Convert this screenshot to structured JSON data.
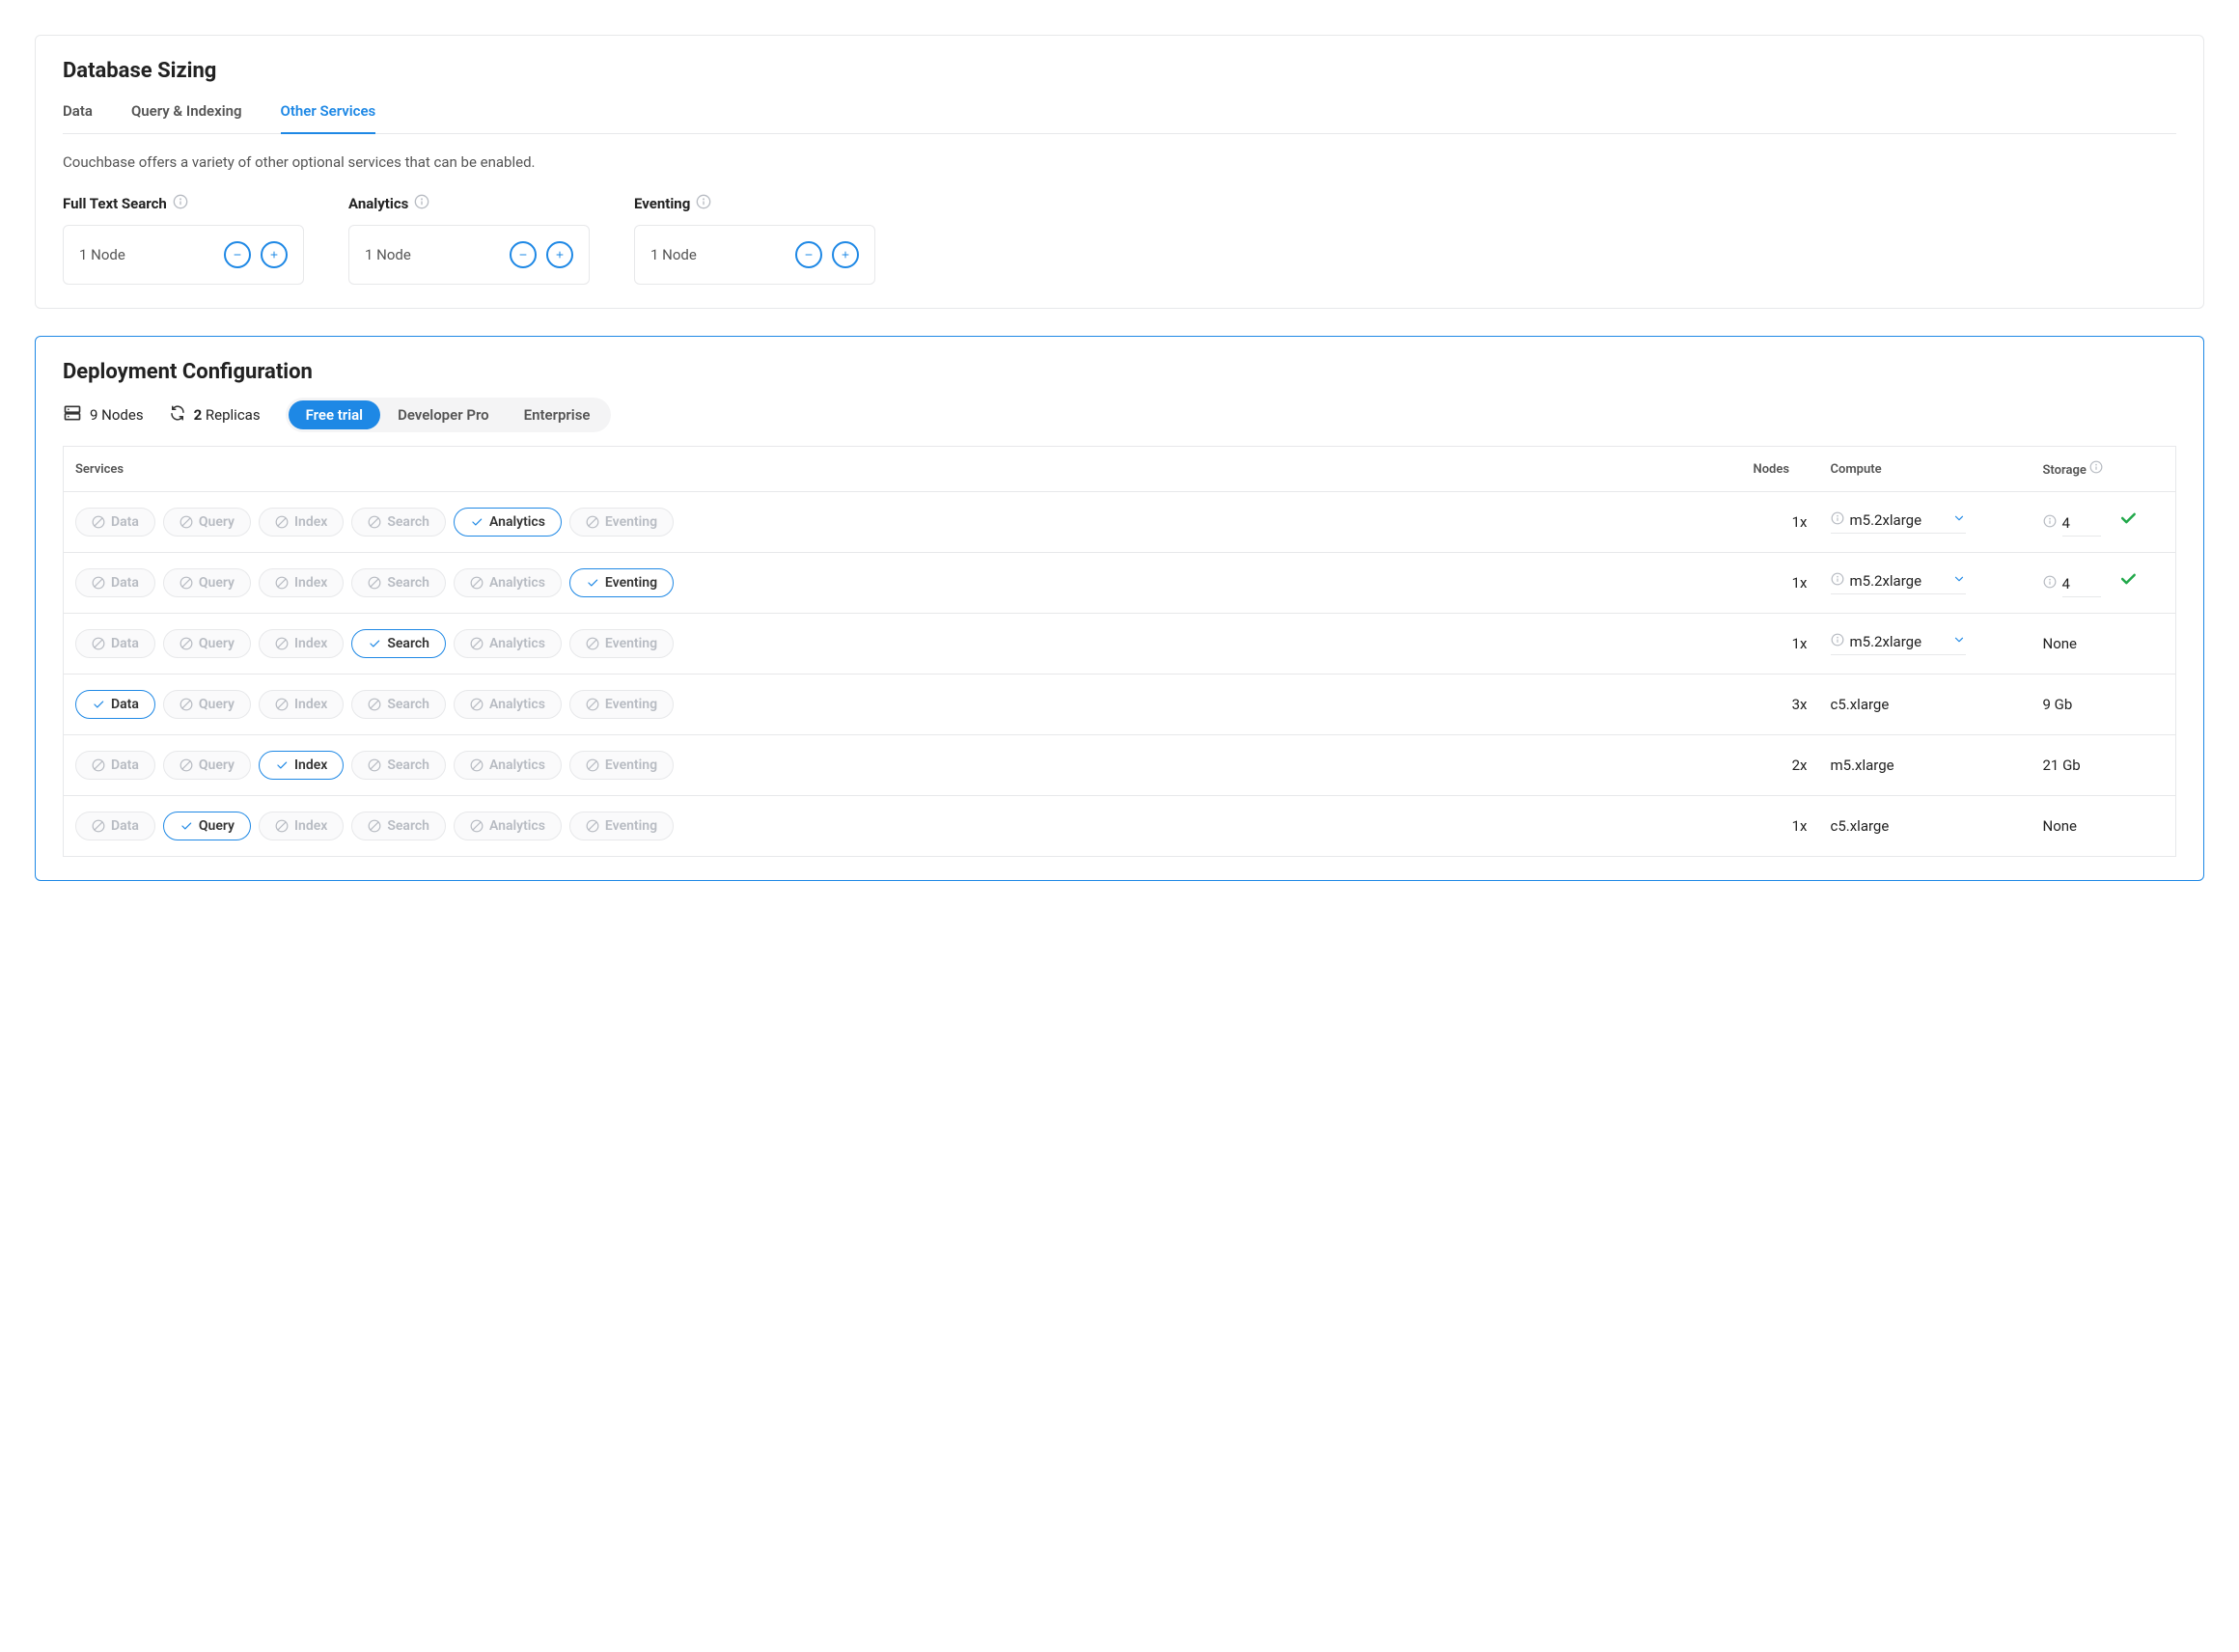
{
  "sizing": {
    "title": "Database Sizing",
    "tabs": [
      "Data",
      "Query & Indexing",
      "Other Services"
    ],
    "tabs_active_index": 2,
    "description": "Couchbase offers a variety of other optional services that can be enabled.",
    "services": {
      "fts": {
        "label": "Full Text Search",
        "value": "1 Node"
      },
      "analytics": {
        "label": "Analytics",
        "value": "1 Node"
      },
      "eventing": {
        "label": "Eventing",
        "value": "1 Node"
      }
    }
  },
  "deployment": {
    "title": "Deployment Configuration",
    "nodes_total": "9 Nodes",
    "replicas_count": "2",
    "replicas_label": "Replicas",
    "plans": [
      "Free trial",
      "Developer Pro",
      "Enterprise"
    ],
    "plans_active_index": 0,
    "columns": {
      "services": "Services",
      "nodes": "Nodes",
      "compute": "Compute",
      "storage": "Storage"
    },
    "service_pills": [
      "Data",
      "Query",
      "Index",
      "Search",
      "Analytics",
      "Eventing"
    ],
    "rows": [
      {
        "active": "Analytics",
        "nodes": "1x",
        "compute": "m5.2xlarge",
        "compute_editable": true,
        "storage": "4",
        "storage_editable": true,
        "storage_ok": true
      },
      {
        "active": "Eventing",
        "nodes": "1x",
        "compute": "m5.2xlarge",
        "compute_editable": true,
        "storage": "4",
        "storage_editable": true,
        "storage_ok": true
      },
      {
        "active": "Search",
        "nodes": "1x",
        "compute": "m5.2xlarge",
        "compute_editable": true,
        "storage": "None",
        "storage_editable": false
      },
      {
        "active": "Data",
        "nodes": "3x",
        "compute": "c5.xlarge",
        "compute_editable": false,
        "storage": "9 Gb",
        "storage_editable": false
      },
      {
        "active": "Index",
        "nodes": "2x",
        "compute": "m5.xlarge",
        "compute_editable": false,
        "storage": "21 Gb",
        "storage_editable": false
      },
      {
        "active": "Query",
        "nodes": "1x",
        "compute": "c5.xlarge",
        "compute_editable": false,
        "storage": "None",
        "storage_editable": false
      }
    ]
  }
}
